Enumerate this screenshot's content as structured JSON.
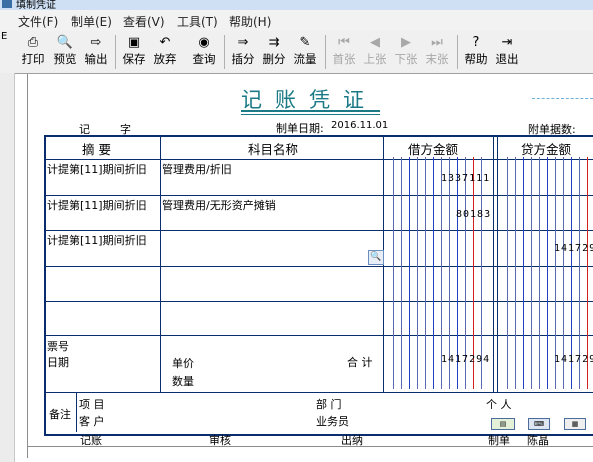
{
  "window": {
    "title": "填制凭证"
  },
  "menu": [
    {
      "label": "文件(F)"
    },
    {
      "label": "制单(E)"
    },
    {
      "label": "查看(V)"
    },
    {
      "label": "工具(T)"
    },
    {
      "label": "帮助(H)"
    }
  ],
  "toolbar": {
    "print": "打印",
    "preview": "预览",
    "export": "输出",
    "save": "保存",
    "discard": "放弃",
    "query": "查询",
    "insert": "插分",
    "delete": "删分",
    "flow": "流量",
    "first": "首张",
    "prev": "上张",
    "next": "下张",
    "last": "末张",
    "help": "帮助",
    "exit": "退出"
  },
  "voucher": {
    "title": "记账凭证",
    "type_label": "记",
    "number_label": "字",
    "date_label": "制单日期:",
    "date": "2016.11.01",
    "attachments_label": "附单据数:",
    "headers": {
      "summary": "摘 要",
      "account": "科目名称",
      "debit": "借方金额",
      "credit": "贷方金额"
    },
    "rows": [
      {
        "summary": "计提第[11]期间折旧",
        "account": "管理费用/折旧",
        "debit": "1337111",
        "credit": ""
      },
      {
        "summary": "计提第[11]期间折旧",
        "account": "管理费用/无形资产摊销",
        "debit": "80183",
        "credit": ""
      },
      {
        "summary": "计提第[11]期间折旧",
        "account": "",
        "debit": "",
        "credit": "141729"
      },
      {
        "summary": "",
        "account": "",
        "debit": "",
        "credit": ""
      },
      {
        "summary": "",
        "account": "",
        "debit": "",
        "credit": ""
      }
    ],
    "ticket_no_label": "票号",
    "date_field_label": "日期",
    "unit_price_label": "单价",
    "quantity_label": "数量",
    "total_label": "合 计",
    "total_debit": "1417294",
    "total_credit": "141729",
    "notes_label": "备注",
    "project_label": "项 目",
    "department_label": "部 门",
    "person_label": "个 人",
    "customer_label": "客 户",
    "salesperson_label": "业务员"
  },
  "footer": {
    "bookkeeper_label": "记账",
    "reviewer_label": "审核",
    "cashier_label": "出纳",
    "maker_label": "制单",
    "maker_name": "陈晶"
  },
  "left_strip": {
    "label": "E"
  }
}
